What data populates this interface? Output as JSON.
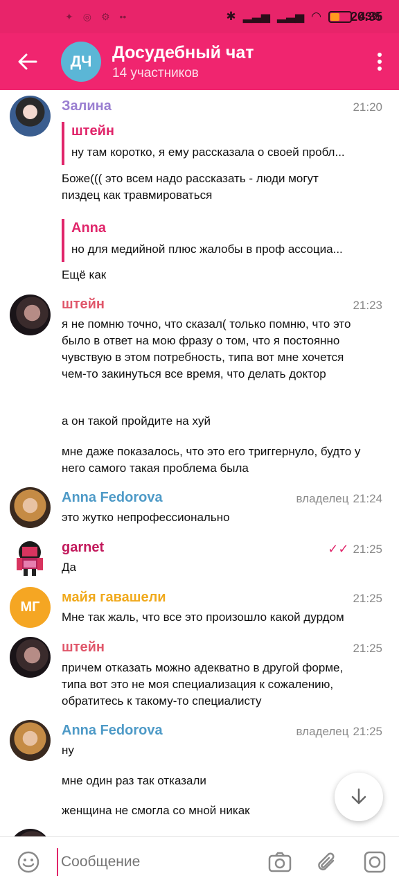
{
  "status": {
    "time": "20:35",
    "battery": "43%",
    "battery_level": 0.43
  },
  "header": {
    "back_icon": "arrow-left-icon",
    "avatar_initials": "ДЧ",
    "title": "Досудебный чат",
    "subtitle": "14 участников",
    "more_icon": "more-vertical-icon"
  },
  "messages": [
    {
      "sender": "Залина",
      "time": "21:20",
      "reply_name": "штейн",
      "reply_text": "ну там коротко, я ему рассказала о своей пробл...",
      "text": "Боже((( это всем надо рассказать - люди могут пиздец как травмироваться"
    },
    {
      "reply_name": "Anna",
      "reply_text": "но для медийной плюс жалобы в проф ассоциа...",
      "text": "Ещё как"
    },
    {
      "sender": "штейн",
      "time": "21:23",
      "p1": "я не помню точно, что сказал( только помню, что это было в ответ на мою фразу о том, что я постоянно чувствую в этом потребность, типа вот мне хочется чем-то закинуться все время, что делать доктор",
      "p2": "а он такой пройдите на хуй",
      "p3": "мне даже показалось, что это его триггернуло, будто у него самого такая проблема была"
    },
    {
      "sender": "Anna Fedorova",
      "role": "владелец",
      "time": "21:24",
      "text": "это жутко непрофессионально"
    },
    {
      "sender": "garnet",
      "time": "21:25",
      "text": "Да"
    },
    {
      "sender": "майя гавашели",
      "avatar_initials": "МГ",
      "time": "21:25",
      "text": "Мне так жаль, что все это произошло какой дурдом"
    },
    {
      "sender": "штейн",
      "time": "21:25",
      "text": "причем отказать можно адекватно в другой форме, типа вот это не моя специализация к сожалению, обратитесь к такому-то специалисту"
    },
    {
      "sender": "Anna Fedorova",
      "role": "владелец",
      "time": "21:25",
      "p1": "ну",
      "p2": "мне один раз так отказали",
      "p3": "женщина не смогла со мной никак"
    }
  ],
  "input": {
    "placeholder": "Сообщение"
  },
  "colors": {
    "header": "#f0256f",
    "accent": "#e0256a"
  }
}
